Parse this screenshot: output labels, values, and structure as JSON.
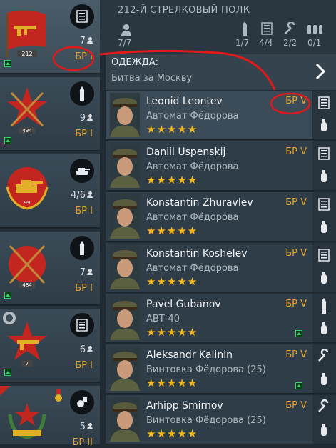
{
  "header": {
    "unit_title": "212-Й СТРЕЛКОВЫЙ ПОЛК",
    "soldiers": "7/7",
    "stat1": "1/7",
    "stat2": "4/4",
    "stat3": "2/2",
    "stat4": "0/1"
  },
  "uniform": {
    "label": "ОДЕЖДА:",
    "value": "Битва за Москву"
  },
  "squads": [
    {
      "number": "212",
      "count": "7",
      "br": "БР I",
      "icon": "list-icon"
    },
    {
      "number": "494",
      "count": "9",
      "br": "БР I",
      "icon": "bullet-icon"
    },
    {
      "number": "99",
      "count": "4/6",
      "br": "БР I",
      "icon": "tank-icon"
    },
    {
      "number": "484",
      "count": "7",
      "br": "БР I",
      "icon": "bullet-icon"
    },
    {
      "number": "7",
      "count": "6",
      "br": "БР I",
      "icon": "list-icon"
    },
    {
      "number": "",
      "count": "5",
      "br": "БР II",
      "icon": "grenade-icon"
    }
  ],
  "soldiers": [
    {
      "name": "Leonid Leontev",
      "weapon": "Автомат Фёдорова",
      "br": "БР V",
      "stars": "★★★★★",
      "icon": "list-icon"
    },
    {
      "name": "Daniil Uspenskij",
      "weapon": "Автомат Фёдорова",
      "br": "БР V",
      "stars": "★★★★★",
      "icon": "list-icon"
    },
    {
      "name": "Konstantin Zhuravlev",
      "weapon": "Автомат Фёдорова",
      "br": "БР V",
      "stars": "★★★★★",
      "icon": "list-icon"
    },
    {
      "name": "Konstantin Koshelev",
      "weapon": "Автомат Фёдорова",
      "br": "БР V",
      "stars": "★★★★★",
      "icon": "list-icon"
    },
    {
      "name": "Pavel Gubanov",
      "weapon": "АВТ-40",
      "br": "БР V",
      "stars": "★★★★★",
      "icon": "bullet-icon"
    },
    {
      "name": "Aleksandr Kalinin",
      "weapon": "Винтовка Фёдорова (25)",
      "br": "БР V",
      "stars": "★★★★★",
      "icon": "wrench-icon"
    },
    {
      "name": "Arhipp Smirnov",
      "weapon": "Винтовка Фёдорова (25)",
      "br": "БР V",
      "stars": "★★★★★",
      "icon": "wrench-icon"
    }
  ],
  "colors": {
    "accent": "#e5a42b",
    "stars": "#f3b81c",
    "annotation": "#e01a1a"
  }
}
